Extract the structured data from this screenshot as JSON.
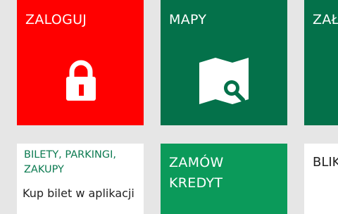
{
  "tiles": {
    "zaloguj": {
      "title": "ZALOGUJ",
      "color": "#ff0000",
      "icon": "padlock-icon"
    },
    "mapy": {
      "title": "MAPY",
      "color": "#04714a",
      "icon": "map-search-icon"
    },
    "partial_top": {
      "title": "ZAŁ"
    },
    "bilety": {
      "heading_line1": "BILETY, PARKINGI,",
      "heading_line2": "ZAKUPY",
      "body": "Kup bilet w aplikacji"
    },
    "kredyt": {
      "title_line1": "ZAMÓW",
      "title_line2": "KREDYT",
      "color": "#0b9a5a"
    },
    "partial_bottom": {
      "title": "BLIK"
    }
  },
  "colors": {
    "background": "#e6e6e6",
    "green": "#04714a",
    "red": "#ff0000",
    "light_green": "#0b9a5a"
  }
}
